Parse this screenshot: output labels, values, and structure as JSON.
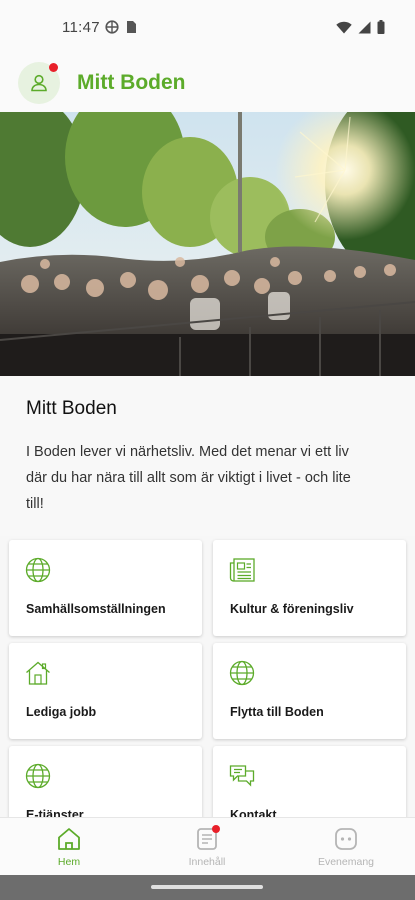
{
  "status_bar": {
    "time": "11:47"
  },
  "header": {
    "title": "Mitt Boden",
    "accent_color": "#5cab2a",
    "avatar_icon": "user-icon",
    "notification_color": "#e8202a"
  },
  "hero": {
    "image_description_icon": "concert-crowd-photo"
  },
  "intro": {
    "title": "Mitt Boden",
    "text_line1": "I Boden lever vi närhetsliv. Med det menar vi ett liv",
    "text_line2": "där du har nära till allt som är viktigt i livet - och lite",
    "text_line3": "till!"
  },
  "tiles": [
    {
      "label": "Samhällsomställningen",
      "icon": "globe-icon"
    },
    {
      "label": "Kultur & föreningsliv",
      "icon": "newspaper-icon"
    },
    {
      "label": "Lediga jobb",
      "icon": "house-icon"
    },
    {
      "label": "Flytta till Boden",
      "icon": "globe-icon"
    },
    {
      "label": "E-tjänster",
      "icon": "globe-icon"
    },
    {
      "label": "Kontakt",
      "icon": "chat-icon"
    }
  ],
  "bottom_nav": [
    {
      "label": "Hem",
      "icon": "home-icon",
      "active": true
    },
    {
      "label": "Innehåll",
      "icon": "document-icon",
      "active": false
    },
    {
      "label": "Evenemang",
      "icon": "event-icon",
      "active": false
    }
  ]
}
